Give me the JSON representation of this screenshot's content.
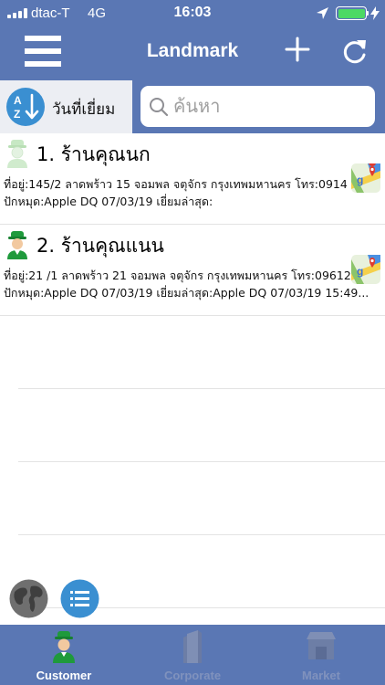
{
  "status_bar": {
    "carrier": "dtac-T",
    "network": "4G",
    "time": "16:03",
    "battery_color": "#4cd964"
  },
  "nav": {
    "title": "Landmark",
    "menu_icon": "hamburger-icon",
    "add_icon": "plus-icon",
    "refresh_icon": "refresh-icon"
  },
  "filter": {
    "sort_label": "วันที่เยี่ยม",
    "sort_icon": "sort-az-icon",
    "search_placeholder": "ค้นหา",
    "search_value": ""
  },
  "customers": [
    {
      "name": "1. ร้านคุณนก",
      "address_line": "ที่อยู่:145/2  ลาดพร้าว 15 จอมพล จตุจักร กรุงเทพมหานคร    โทร:0914",
      "pin_line": "ปักหมุด:Apple DQ 07/03/19    เยี่ยมล่าสุด:",
      "avatar": "customer-avatar-faded",
      "map_icon": "google-maps-icon"
    },
    {
      "name": "2. ร้านคุณแนน",
      "address_line": "ที่อยู่:21 /1 ลาดพร้าว 21 จอมพล จตุจักร  กรุงเทพมหานคร    โทร:09612",
      "pin_line": "ปักหมุด:Apple DQ 07/03/19    เยี่ยมล่าสุด:Apple DQ 07/03/19 15:49...",
      "avatar": "customer-avatar-green",
      "map_icon": "google-maps-icon"
    }
  ],
  "floating_buttons": {
    "globe_icon": "globe-icon",
    "list_icon": "list-icon"
  },
  "tabs": [
    {
      "label": "Customer",
      "icon": "customer-icon",
      "active": true
    },
    {
      "label": "Corporate",
      "icon": "building-icon",
      "active": false
    },
    {
      "label": "Market",
      "icon": "market-icon",
      "active": false
    }
  ],
  "colors": {
    "primary": "#5a77b4",
    "accent_blue": "#3a8fd1",
    "tab_inactive": "#8092bd"
  }
}
